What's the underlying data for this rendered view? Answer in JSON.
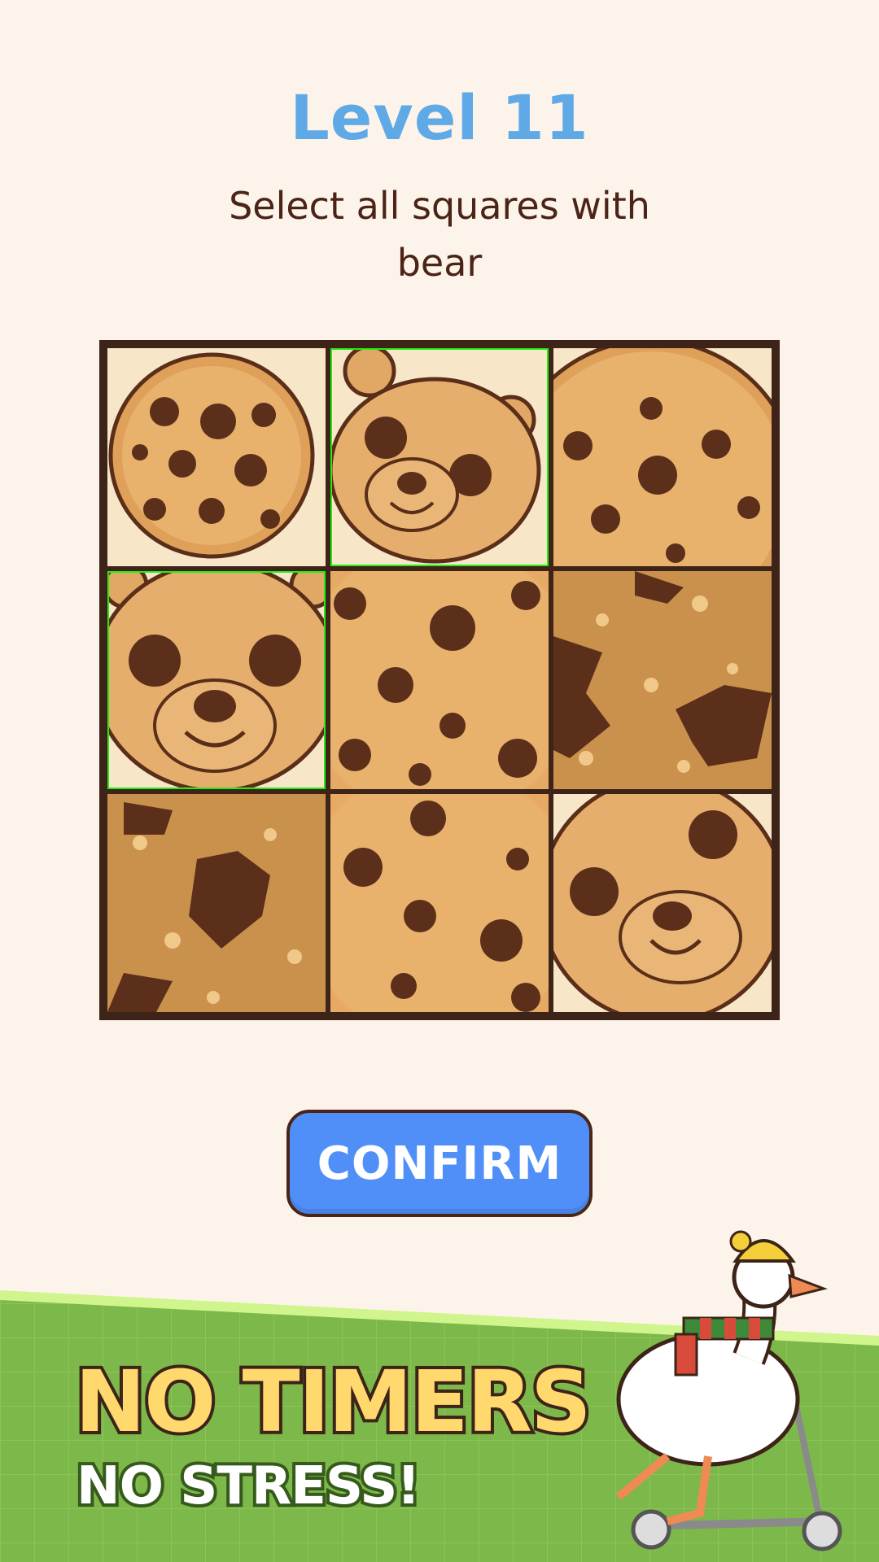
{
  "level": {
    "title": "Level 11"
  },
  "instruction": {
    "text": "Select all squares with bear"
  },
  "grid": {
    "tiles": [
      {
        "content": "cookie",
        "selected": false
      },
      {
        "content": "bear",
        "selected": true
      },
      {
        "content": "cookie",
        "selected": false
      },
      {
        "content": "bear",
        "selected": true
      },
      {
        "content": "cookie",
        "selected": false
      },
      {
        "content": "broken-cookie",
        "selected": false
      },
      {
        "content": "broken-cookie",
        "selected": false
      },
      {
        "content": "cookie",
        "selected": false
      },
      {
        "content": "bear",
        "selected": false
      }
    ],
    "selection_color": "#22ee11"
  },
  "confirm": {
    "label": "CONFIRM",
    "color": "#4f8ff7"
  },
  "promo": {
    "line1": "NO TIMERS",
    "line2": "NO STRESS!"
  },
  "icons": {
    "mascot": "goose-on-scooter-icon"
  }
}
